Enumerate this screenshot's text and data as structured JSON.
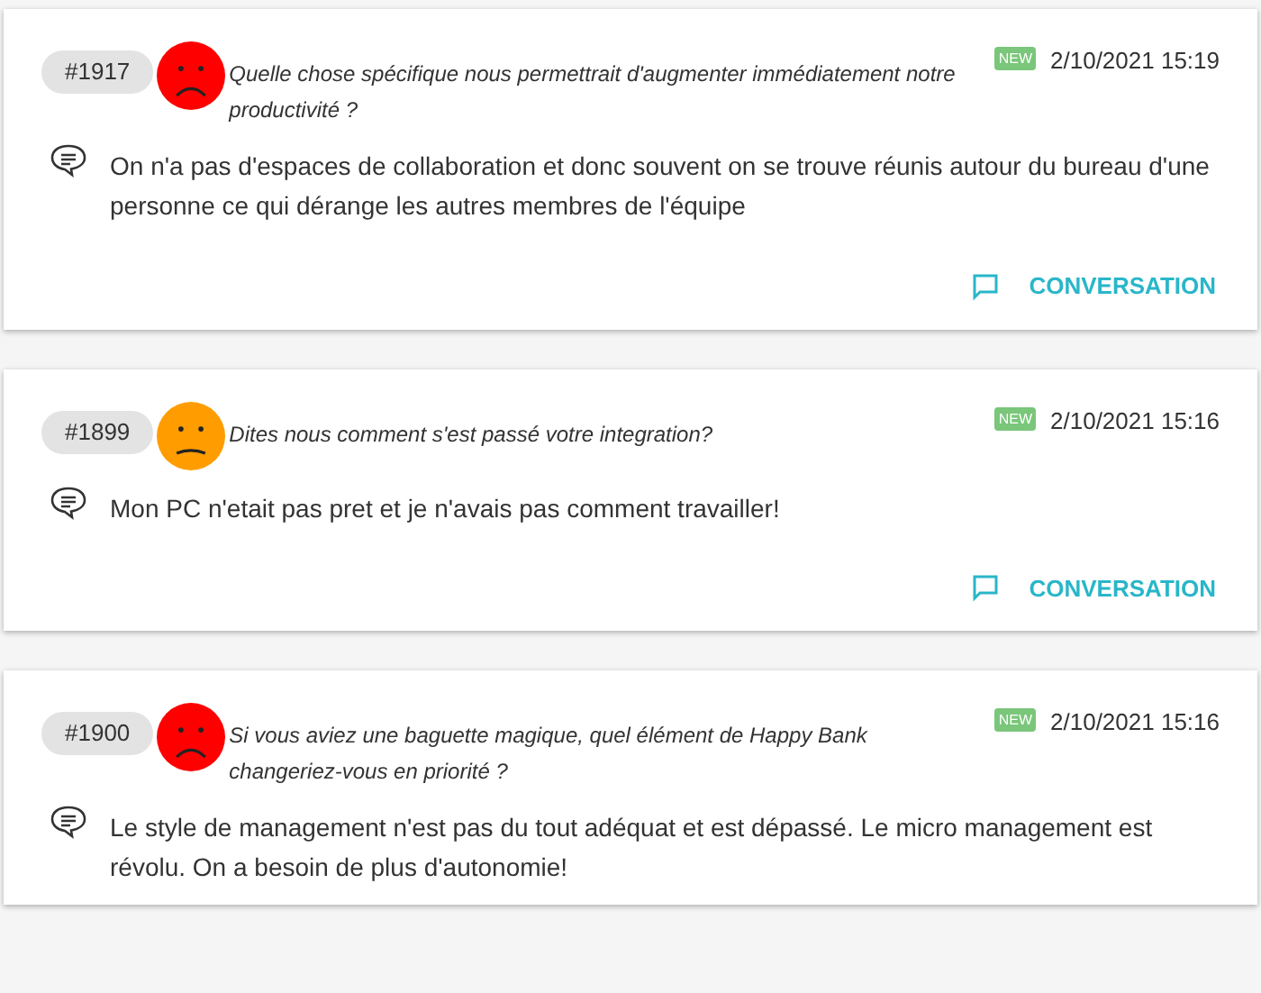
{
  "cards": [
    {
      "number": "#1917",
      "face": {
        "kind": "sad",
        "color": "#ff0000"
      },
      "question": "Quelle chose spécifique nous permettrait d'augmenter immédiatement notre productivité ?",
      "new_badge": "NEW",
      "date": "2/10/2021 15:19",
      "answer": "On n'a pas d'espaces de collaboration et donc souvent on se trouve réunis autour du bureau d'une personne ce qui dérange les autres membres de l'équipe",
      "conversation_button": "CONVERSATION"
    },
    {
      "number": "#1899",
      "face": {
        "kind": "neutral",
        "color": "#ff9d00"
      },
      "question": "Dites nous comment s'est passé votre integration?",
      "new_badge": "NEW",
      "date": "2/10/2021 15:16",
      "answer": "Mon PC n'etait pas pret et je n'avais pas comment travailler!",
      "conversation_button": "CONVERSATION"
    },
    {
      "number": "#1900",
      "face": {
        "kind": "sad",
        "color": "#ff0000"
      },
      "question": "Si vous aviez une baguette magique, quel élément de Happy Bank changeriez-vous en priorité ?",
      "new_badge": "NEW",
      "date": "2/10/2021 15:16",
      "answer": "Le style de management n'est pas du tout adéquat et est dépassé. Le micro management est révolu. On a besoin de plus d'autonomie!"
    }
  ]
}
